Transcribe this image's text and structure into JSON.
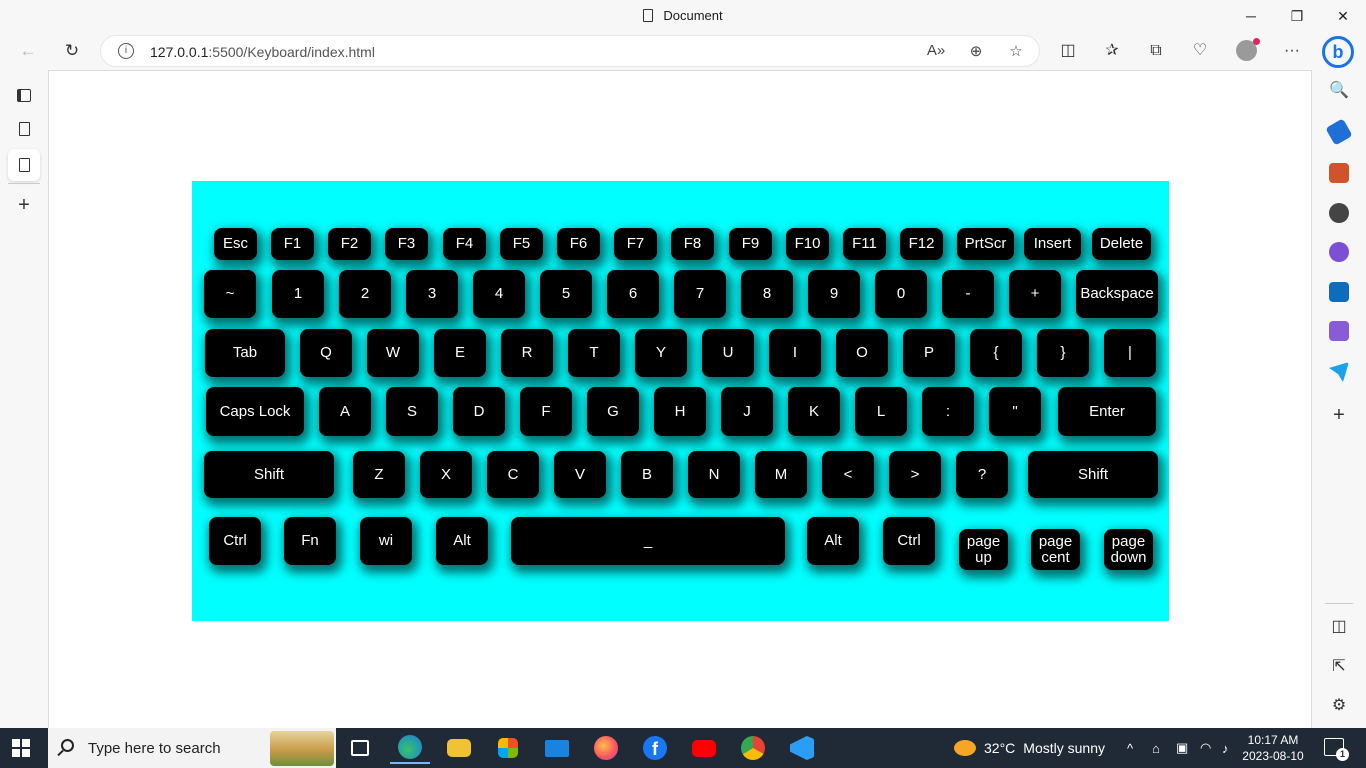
{
  "window": {
    "title": "Document",
    "minimize_glyph": "─",
    "maximize_glyph": "❐",
    "close_glyph": "✕"
  },
  "browser": {
    "back_glyph": "←",
    "refresh_glyph": "↻",
    "url_host": "127.0.0.1",
    "url_path": ":5500/Keyboard/index.html",
    "read_aloud_glyph": "A»",
    "zoom_glyph": "⊕",
    "favorite_glyph": "☆",
    "split_glyph": "◫",
    "favorites_glyph": "✰",
    "collections_glyph": "⧉",
    "performance_glyph": "♡",
    "more_glyph": "···",
    "bing_glyph": "b"
  },
  "left_strip": {
    "add_glyph": "+"
  },
  "right_sidebar": {
    "search_glyph": "🔍",
    "add_glyph": "+",
    "icons": [
      "search-icon",
      "shopping-icon",
      "tools-icon",
      "games-icon",
      "microsoft-365-icon",
      "outlook-icon",
      "designer-icon",
      "send-icon"
    ],
    "colors": {
      "shopping": "#1f6fd6",
      "tools": "#d0542b",
      "games": "#444444",
      "m365": "#7b4fd6",
      "outlook": "#0f6cbd",
      "designer": "#8a5bd6",
      "send": "#1aa3e8"
    }
  },
  "page": {
    "background": "#00ffff",
    "rows": [
      [
        "Esc",
        "F1",
        "F2",
        "F3",
        "F4",
        "F5",
        "F6",
        "F7",
        "F8",
        "F9",
        "F10",
        "F11",
        "F12",
        "PrtScr",
        "Insert",
        "Delete"
      ],
      [
        "~",
        "1",
        "2",
        "3",
        "4",
        "5",
        "6",
        "7",
        "8",
        "9",
        "0",
        "-",
        "+",
        "Backspace"
      ],
      [
        "Tab",
        "Q",
        "W",
        "E",
        "R",
        "T",
        "Y",
        "U",
        "I",
        "O",
        "P",
        "{",
        "}",
        "|"
      ],
      [
        "Caps Lock",
        "A",
        "S",
        "D",
        "F",
        "G",
        "H",
        "J",
        "K",
        "L",
        ":",
        "\"",
        "Enter"
      ],
      [
        "Shift",
        "Z",
        "X",
        "C",
        "V",
        "B",
        "N",
        "M",
        "<",
        ">",
        "?",
        "Shift"
      ],
      [
        "Ctrl",
        "Fn",
        "wi",
        "Alt",
        "_",
        "Alt",
        "Ctrl",
        "page\nup",
        "page\ncent",
        "page\ndown"
      ]
    ]
  },
  "taskbar": {
    "search_placeholder": "Type here to search",
    "apps": [
      "task-view-icon",
      "edge-icon",
      "file-explorer-icon",
      "store-icon",
      "mail-icon",
      "firefox-icon",
      "facebook-icon",
      "youtube-icon",
      "chrome-icon",
      "vscode-icon"
    ],
    "weather_temp": "32°C",
    "weather_text": "Mostly sunny",
    "tray_chevron": "^",
    "time": "10:17 AM",
    "date": "2023-08-10",
    "notification_count": "1"
  }
}
